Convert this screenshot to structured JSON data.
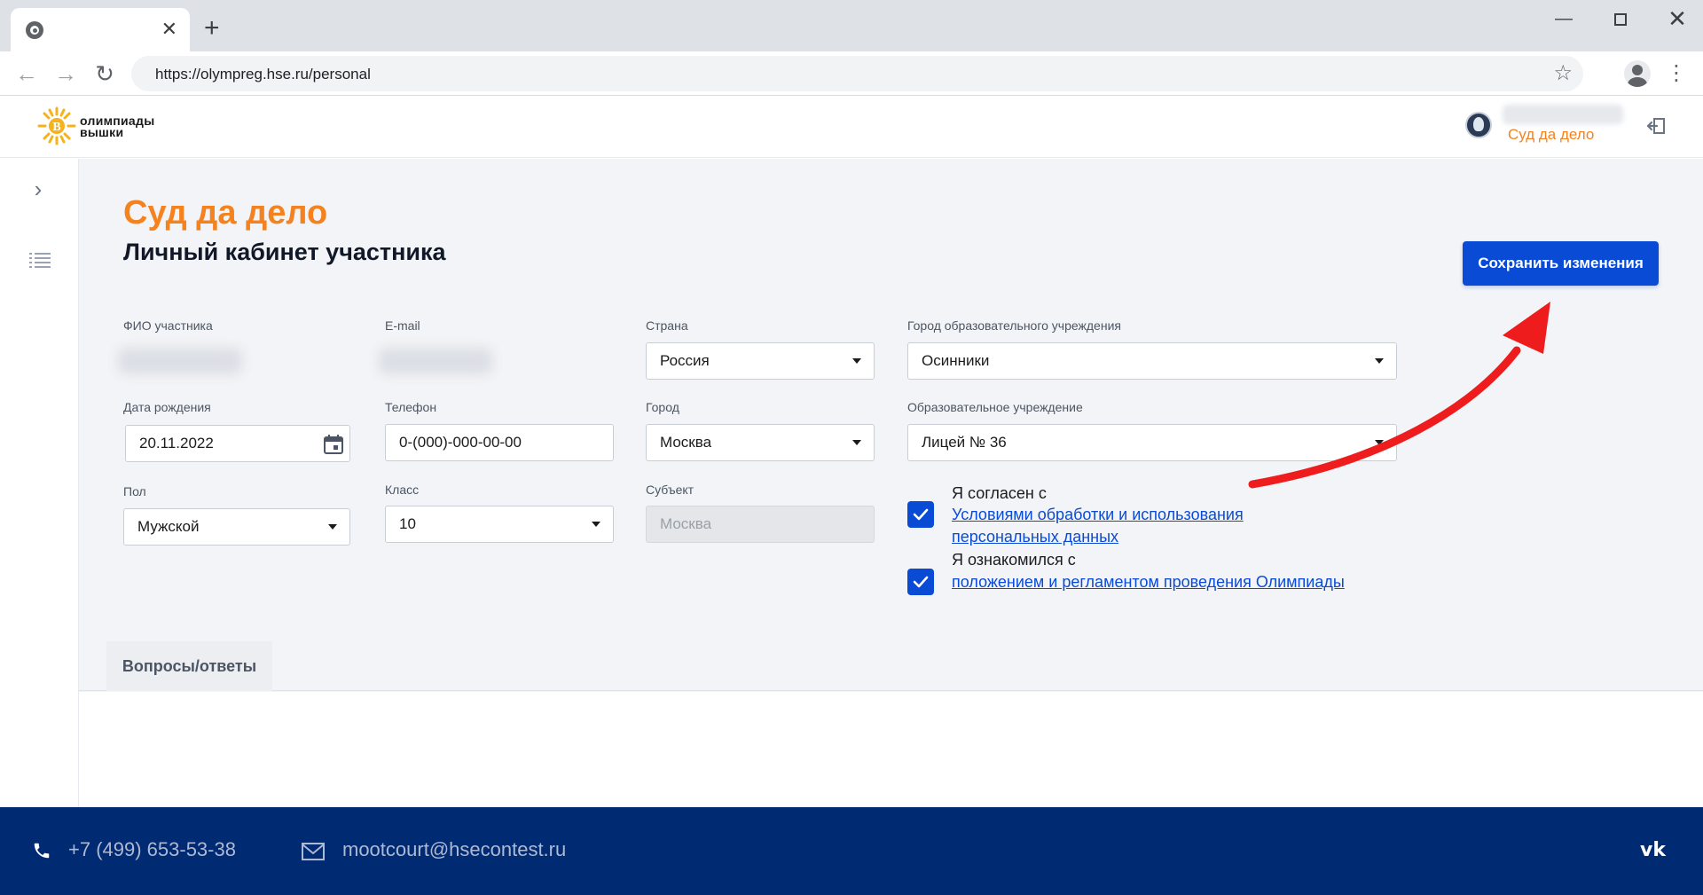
{
  "browser": {
    "url": "https://olympreg.hse.ru/personal",
    "new_tab_label": "+",
    "tab_close": "✕"
  },
  "site": {
    "logo_line1": "олимпиады",
    "logo_line2": "вышки",
    "user_team": "Суд да дело",
    "colors": {
      "accent": "#f4821f",
      "primary": "#0a4bd6",
      "footer": "#002a72"
    }
  },
  "page": {
    "team_name": "Суд да дело",
    "title": "Личный кабинет участника",
    "save_button": "Сохранить изменения"
  },
  "form": {
    "fio_label": "ФИО участника",
    "email_label": "E-mail",
    "country_label": "Страна",
    "country_value": "Россия",
    "school_city_label": "Город образовательного учреждения",
    "school_city_value": "Осинники",
    "birth_label": "Дата рождения",
    "birth_value": "20.11.2022",
    "phone_label": "Телефон",
    "phone_value": "0-(000)-000-00-00",
    "city_label": "Город",
    "city_value": "Москва",
    "school_label": "Образовательное учреждение",
    "school_value": "Лицей № 36",
    "gender_label": "Пол",
    "gender_value": "Мужской",
    "grade_label": "Класс",
    "grade_value": "10",
    "region_label": "Субъект",
    "region_value": "Москва",
    "consent1_text": "Я согласен с",
    "consent1_link_line1": "Условиями обработки и использования",
    "consent1_link_line2": "персональных данных",
    "consent2_text": "Я ознакомился с",
    "consent2_link": "положением и регламентом проведения Олимпиады"
  },
  "tabs": {
    "qa": "Вопросы/ответы"
  },
  "footer": {
    "phone": "+7 (499) 653-53-38",
    "email": "mootcourt@hsecontest.ru",
    "vk": "vk"
  }
}
